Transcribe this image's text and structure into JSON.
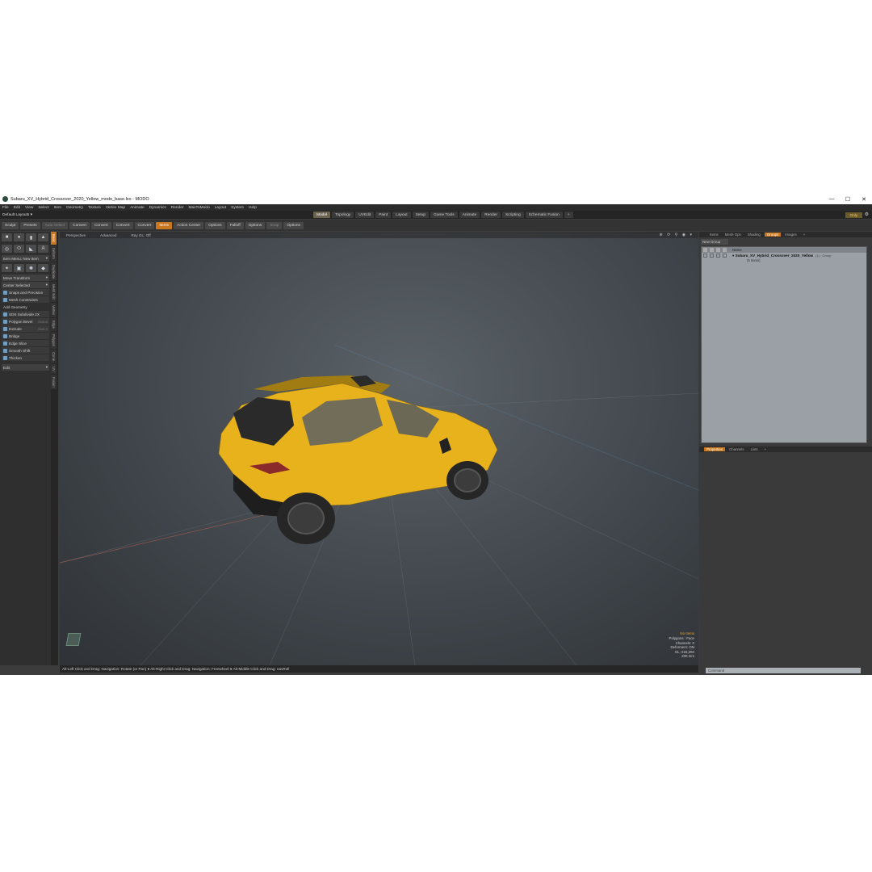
{
  "window": {
    "title": "Subaru_XV_Hybrid_Crossover_2020_Yellow_modo_base.lxo - MODO",
    "controls": [
      "—",
      "☐",
      "✕"
    ]
  },
  "menubar": [
    "File",
    "Edit",
    "View",
    "Select",
    "Item",
    "Geometry",
    "Texture",
    "Vertex Map",
    "Animate",
    "Dynamics",
    "Render",
    "MaxToModo",
    "Layout",
    "System",
    "Help"
  ],
  "layoutbar": {
    "layout": "Default Layouts ▾",
    "tabs": [
      "Model",
      "Topology",
      "UVEdit",
      "Paint",
      "Layout",
      "Setup",
      "Game Tools",
      "Animate",
      "Render",
      "Scripting",
      "Schematic Fusion",
      "+"
    ],
    "active_tab": "Model",
    "only": "Only"
  },
  "toolbar": {
    "sculpt": "Sculpt",
    "presets": "Presets",
    "auto_select": "Auto Select",
    "convert1": "Convert",
    "convert2": "Convert",
    "convert3": "Convert",
    "convert4": "Convert",
    "items": "Items",
    "action_center": "Action Center",
    "options1": "Options",
    "falloff": "Falloff",
    "options2": "Options",
    "snap": "Snap",
    "options3": "Options"
  },
  "leftpanel": {
    "item_menu": "Item Menu: New Item",
    "move_transform": "Move Transform",
    "center_selected": "Center Selected",
    "snapping": "Snaps and Precision",
    "mesh_constraints": "Mesh Constraints",
    "add_geometry": "Add Geometry",
    "tools": [
      {
        "label": "SDS Subdivide 2X",
        "shortcut": ""
      },
      {
        "label": "Polygon Bevel",
        "shortcut": "Shift-B"
      },
      {
        "label": "Extrude",
        "shortcut": "Shift-X"
      },
      {
        "label": "Bridge",
        "shortcut": ""
      },
      {
        "label": "Edge Slice",
        "shortcut": ""
      },
      {
        "label": "Smooth Shift",
        "shortcut": ""
      },
      {
        "label": "Thicken",
        "shortcut": ""
      }
    ],
    "edit": "Edit"
  },
  "vtabs": [
    "Basic",
    "Deform",
    "Duplicate",
    "Mesh Edit",
    "Vertex",
    "Edge",
    "Polygon",
    "Curve",
    "UV",
    "Fusion"
  ],
  "viewport": {
    "header": [
      "Perspective",
      "Advanced",
      "Ray GL: Off"
    ],
    "icons": "⊕ ⟳ ⚲ ◉ ▾",
    "info": {
      "selection": "No Items",
      "polygons": "Polygons : Face",
      "channels": "Channels: 0",
      "deformers": "Deformers: ON",
      "gl": "GL: 615,394",
      "scale": "200 mm"
    }
  },
  "statusbar": "Alt-Left Click and Drag: Navigation: Rotate (or Pan) ● Alt-Right Click and Drag: Navigation: Freewheel ● Alt-Middle Click and Drag: navRoll",
  "rightpanel": {
    "tabs": [
      "Items",
      "Mesh Ops",
      "Shading",
      "Groups",
      "Images",
      "+"
    ],
    "active_tab": "Groups",
    "new_group": "New Group",
    "col_name": "Name",
    "group_name": "Subaru_XV_Hybrid_Crossover_2020_Yellow",
    "group_type": "(1) : Group",
    "group_sub": "(5 Items)",
    "lower_tabs": [
      "Properties",
      "Channels",
      "Lists",
      "+"
    ],
    "lower_active": "Properties",
    "command_placeholder": "Command"
  },
  "colors": {
    "accent": "#c9771e",
    "car": "#e8b21c",
    "viewport_bg": "#4a5056"
  }
}
